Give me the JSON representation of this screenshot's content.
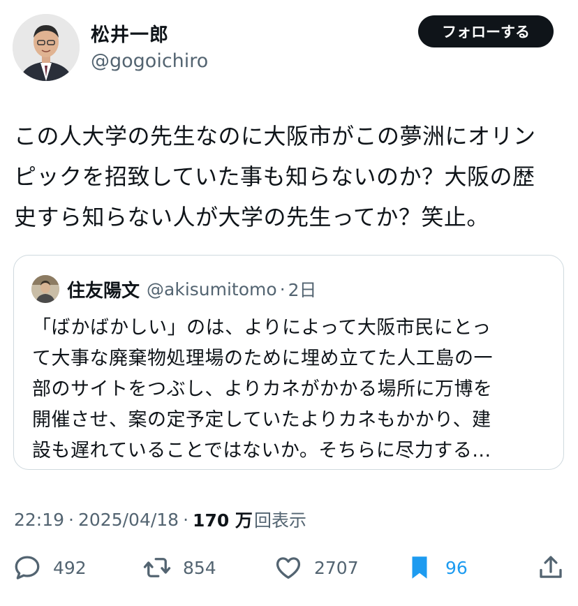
{
  "author": {
    "name": "松井一郎",
    "handle": "@gogoichiro",
    "follow_label": "フォローする"
  },
  "tweet": {
    "text": "この人大学の先生なのに大阪市がこの夢洲にオリン\nピックを招致していた事も知らないのか？大阪の歴\n史すら知らない人が大学の先生ってか？笑止。"
  },
  "quote": {
    "name": "住友陽文",
    "handle": "@akisumitomo",
    "dot": "·",
    "time": "2日",
    "text": "「ばかばかしい」のは、よりによって大阪市民にとっ\nて大事な廃棄物処理場のために埋め立てた人工島の一\n部のサイトをつぶし、よりカネがかかる場所に万博を\n開催させ、案の定予定していたよりカネもかかり、建\n設も遅れていることではないか。そちらに尽力する..."
  },
  "meta": {
    "time": "22:19",
    "sep1": "·",
    "date": "2025/04/18",
    "sep2": "·",
    "views_count": "170 万",
    "views_label": "回表示"
  },
  "actions": {
    "replies": "492",
    "reposts": "854",
    "likes": "2707",
    "bookmarks": "96"
  },
  "colors": {
    "text": "#0f1419",
    "secondary": "#536471",
    "border": "#cfd9de",
    "accent": "#1d9bf0",
    "follow_bg": "#0f1419"
  },
  "icons": {
    "reply": "reply-icon",
    "repost": "repost-icon",
    "like": "heart-icon",
    "bookmark": "bookmark-icon",
    "share": "share-icon"
  }
}
